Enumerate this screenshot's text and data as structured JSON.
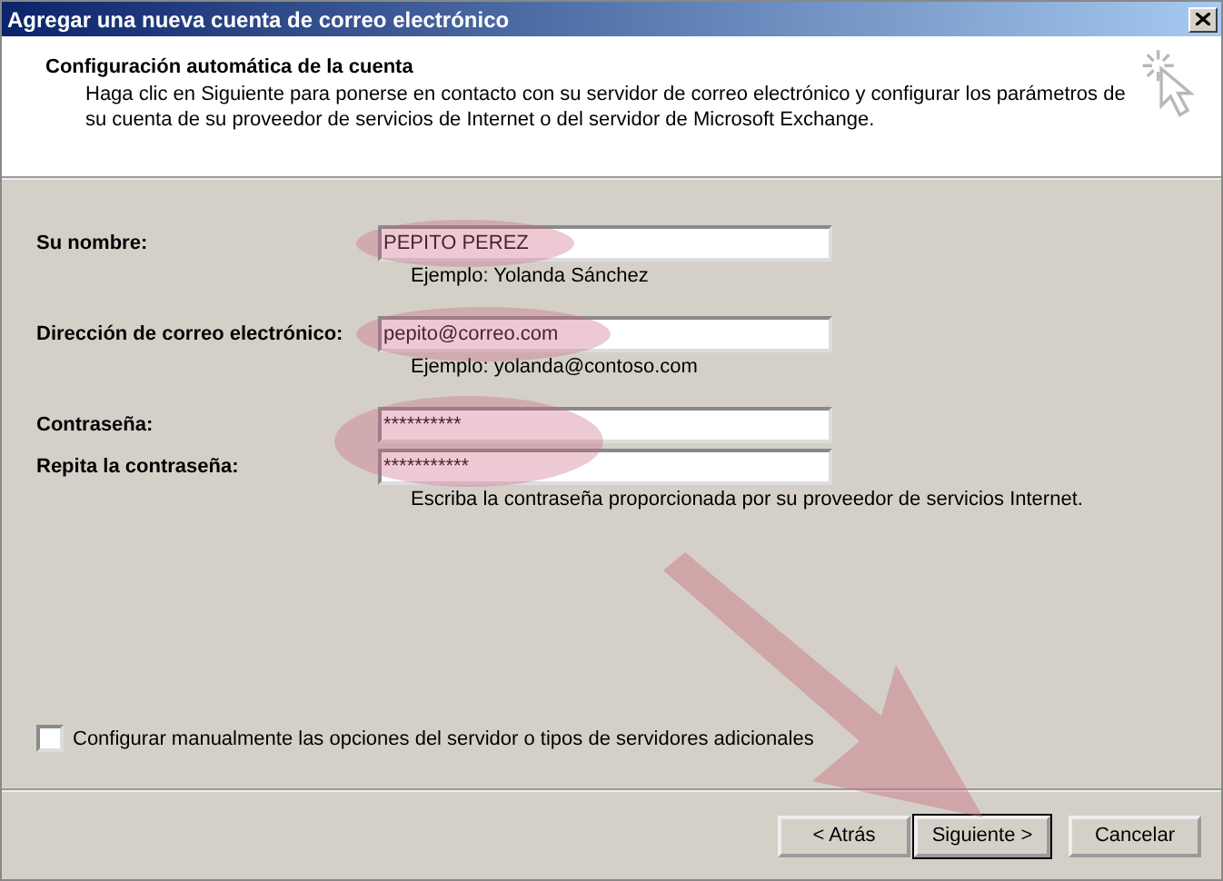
{
  "window": {
    "title": "Agregar una nueva cuenta de correo electrónico"
  },
  "header": {
    "title": "Configuración automática de la cuenta",
    "description": "Haga clic en Siguiente para ponerse en contacto con su servidor de correo electrónico y configurar los parámetros de su cuenta de su proveedor de servicios de Internet o del servidor de Microsoft Exchange."
  },
  "fields": [
    {
      "label": "Su nombre:",
      "value": "PEPITO PEREZ",
      "hint": "Ejemplo: Yolanda Sánchez",
      "highlighted": true
    },
    {
      "label": "Dirección de correo electrónico:",
      "value": "pepito@correo.com",
      "hint": "Ejemplo: yolanda@contoso.com",
      "highlighted": true
    },
    {
      "label": "Contraseña:",
      "value": "**********",
      "highlighted": true
    },
    {
      "label": "Repita la contraseña:",
      "value": "***********",
      "hint": "Escriba la contraseña proporcionada por su proveedor de servicios Internet."
    }
  ],
  "manual_setup": {
    "label": "Configurar manualmente las opciones del servidor o tipos de servidores adicionales",
    "checked": false
  },
  "buttons": [
    {
      "label": "< Atrás",
      "default": false
    },
    {
      "label": "Siguiente >",
      "default": true
    },
    {
      "label": "Cancelar",
      "default": false
    }
  ],
  "pointer_arrow": true
}
